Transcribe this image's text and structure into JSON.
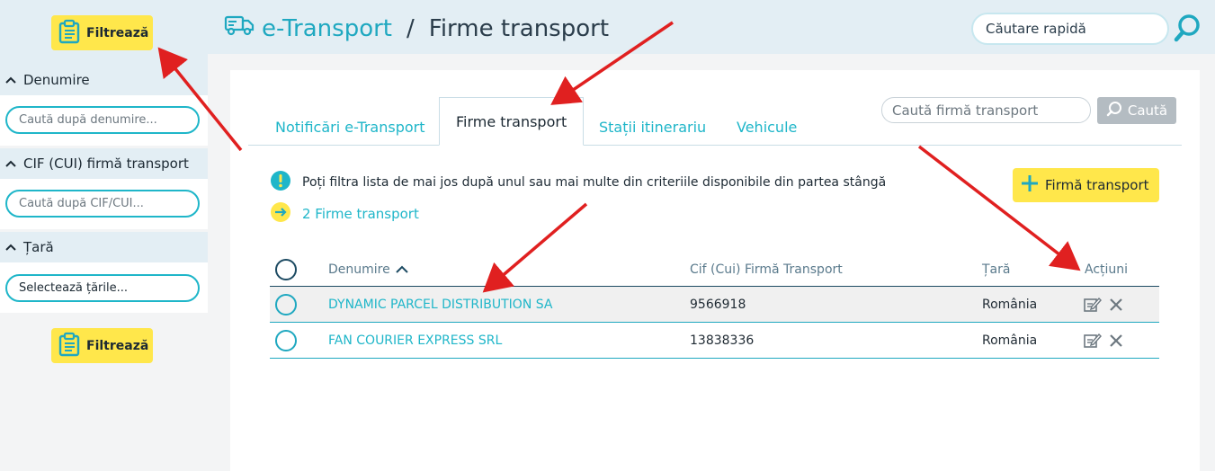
{
  "sidebar": {
    "filter_label": "Filtrează",
    "sections": [
      {
        "title": "Denumire",
        "placeholder": "Caută după denumire..."
      },
      {
        "title": "CIF (CUI) firmă transport",
        "placeholder": "Caută după CIF/CUI..."
      },
      {
        "title": "Țară",
        "placeholder": "Selectează țările..."
      }
    ]
  },
  "header": {
    "app_name": "e-Transport",
    "separator": "/",
    "page_title": "Firme transport",
    "quick_search_placeholder": "Căutare rapidă"
  },
  "tabs": [
    {
      "label": "Notificări e-Transport"
    },
    {
      "label": "Firme transport"
    },
    {
      "label": "Stații itinerariu"
    },
    {
      "label": "Vehicule"
    }
  ],
  "search": {
    "placeholder": "Caută firmă transport",
    "button_label": "Caută"
  },
  "info_text": "Poți filtra lista de mai jos după unul sau mai multe din criteriile disponibile din partea stângă",
  "count_text": "2 Firme transport",
  "add_button_label": "Firmă transport",
  "table": {
    "headers": {
      "name": "Denumire",
      "cif": "Cif (Cui) Firmă Transport",
      "country": "Țară",
      "actions": "Acțiuni"
    },
    "rows": [
      {
        "name": "DYNAMIC PARCEL DISTRIBUTION SA",
        "cif": "9566918",
        "country": "România"
      },
      {
        "name": "FAN COURIER EXPRESS SRL",
        "cif": "13838336",
        "country": "România"
      }
    ]
  },
  "colors": {
    "accent": "#1fb6c9",
    "highlight": "#ffe74b",
    "annotation": "#e02020"
  }
}
